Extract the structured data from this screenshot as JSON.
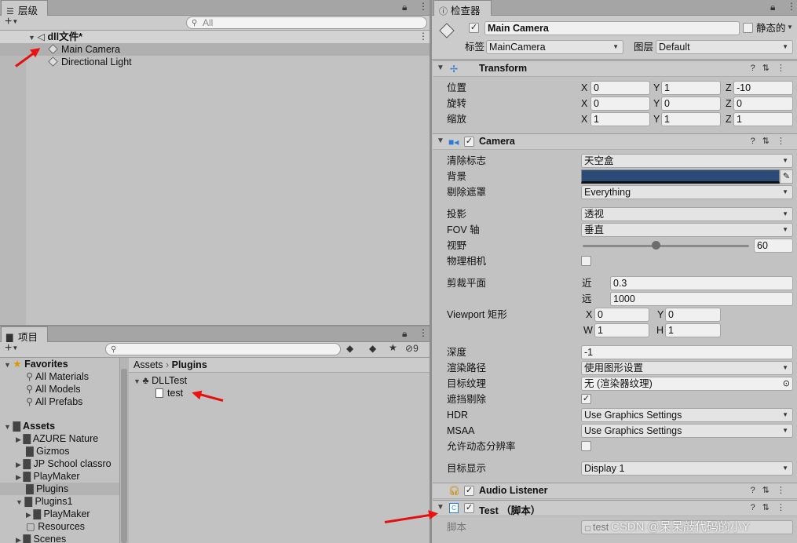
{
  "hierarchy": {
    "tab_label": "层级",
    "search_placeholder": "All",
    "scene_name": "dll文件*",
    "items": [
      "Main Camera",
      "Directional Light"
    ]
  },
  "project": {
    "tab_label": "项目",
    "hidden_count": "9",
    "favorites_label": "Favorites",
    "favorites": [
      "All Materials",
      "All Models",
      "All Prefabs"
    ],
    "assets_label": "Assets",
    "assets": [
      "AZURE Nature",
      "Gizmos",
      "JP School classro",
      "PlayMaker",
      "Plugins",
      "Plugins1",
      "PlayMaker",
      "Resources",
      "Scenes"
    ],
    "breadcrumb_root": "Assets",
    "breadcrumb_current": "Plugins",
    "content_folder": "DLLTest",
    "content_file": "test"
  },
  "inspector": {
    "tab_label": "检查器",
    "object_name": "Main Camera",
    "static_label": "静态的",
    "tag_label": "标签",
    "tag_value": "MainCamera",
    "layer_label": "图层",
    "layer_value": "Default",
    "transform": {
      "title": "Transform",
      "position_label": "位置",
      "rotation_label": "旋转",
      "scale_label": "缩放",
      "x": "X",
      "y": "Y",
      "z": "Z",
      "position": [
        "0",
        "1",
        "-10"
      ],
      "rotation": [
        "0",
        "0",
        "0"
      ],
      "scale": [
        "1",
        "1",
        "1"
      ]
    },
    "camera": {
      "title": "Camera",
      "clear_flags_label": "清除标志",
      "clear_flags": "天空盒",
      "background_label": "背景",
      "background_color": "#2b4a75",
      "culling_label": "剔除遮罩",
      "culling": "Everything",
      "projection_label": "投影",
      "projection": "透视",
      "fov_axis_label": "FOV 轴",
      "fov_axis": "垂直",
      "fov_label": "视野",
      "fov": "60",
      "fov_fraction": 0.44,
      "physical_label": "物理相机",
      "clip_label": "剪裁平面",
      "near_label": "近",
      "near": "0.3",
      "far_label": "远",
      "far": "1000",
      "viewport_label": "Viewport 矩形",
      "vx_label": "X",
      "vx": "0",
      "vy_label": "Y",
      "vy": "0",
      "vw_label": "W",
      "vw": "1",
      "vh_label": "H",
      "vh": "1",
      "depth_label": "深度",
      "depth": "-1",
      "render_path_label": "渲染路径",
      "render_path": "使用图形设置",
      "target_texture_label": "目标纹理",
      "target_texture": "无 (渲染器纹理)",
      "occlusion_label": "遮挡剔除",
      "hdr_label": "HDR",
      "hdr": "Use Graphics Settings",
      "msaa_label": "MSAA",
      "msaa": "Use Graphics Settings",
      "dynamic_res_label": "允许动态分辨率",
      "target_display_label": "目标显示",
      "target_display": "Display 1"
    },
    "audio_listener_title": "Audio Listener",
    "script_component_title": "Test （脚本）",
    "script_label": "脚本",
    "script_value": "test"
  },
  "watermark": "CSDN @呆呆敲代码的小Y",
  "colors": {
    "arrow": "#e11111",
    "selection": "#b3b3b3"
  }
}
